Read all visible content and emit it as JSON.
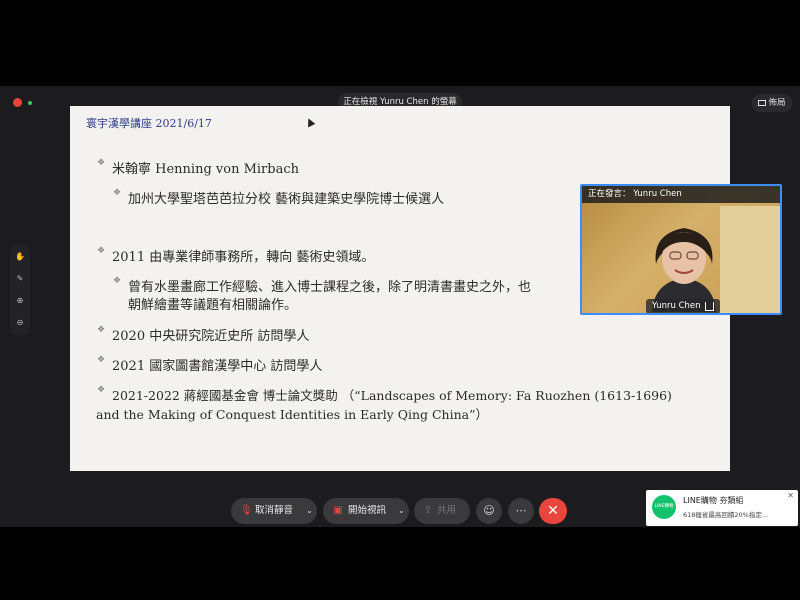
{
  "app": {
    "viewing_label": "正在檢視 Yunru Chen 的螢幕",
    "layout_label": "佈局"
  },
  "side_tools": [
    "hand-icon",
    "draw-icon",
    "zoom-in-icon",
    "zoom-out-icon"
  ],
  "slide": {
    "header": "寰宇漢學講座 2021/6/17",
    "bullets": [
      "米翰寧 Henning von Mirbach",
      "加州大學聖塔芭芭拉分校 藝術與建築史學院博士候選人",
      "2011 由專業律師事務所，轉向 藝術史領域。",
      "曾有水墨畫廊工作經驗、進入博士課程之後，除了明清書畫史之外，也",
      "朝鮮繪畫等議題有相關論作。",
      "2020 中央研究院近史所 訪問學人",
      "2021 國家圖書館漢學中心 訪問學人",
      "2021-2022 蔣經國基金會 博士論文獎助 （“Landscapes of Memory: Fa Ruozhen (1613-1696)",
      "and the Making of Conquest Identities in Early Qing China”）"
    ]
  },
  "participant": {
    "speaking_label": "正在發言： Yunru Chen",
    "name": "Yunru Chen",
    "accent": "#3a8cff"
  },
  "controls": {
    "unmute_label": "取消靜音",
    "video_label": "開始視訊",
    "share_label": "共用",
    "end_color": "#e8453c"
  },
  "notification": {
    "app_name": "LINE購物",
    "title": "LINE購物 夯類組",
    "body": "618瘋省最高回饋20%指定..."
  }
}
